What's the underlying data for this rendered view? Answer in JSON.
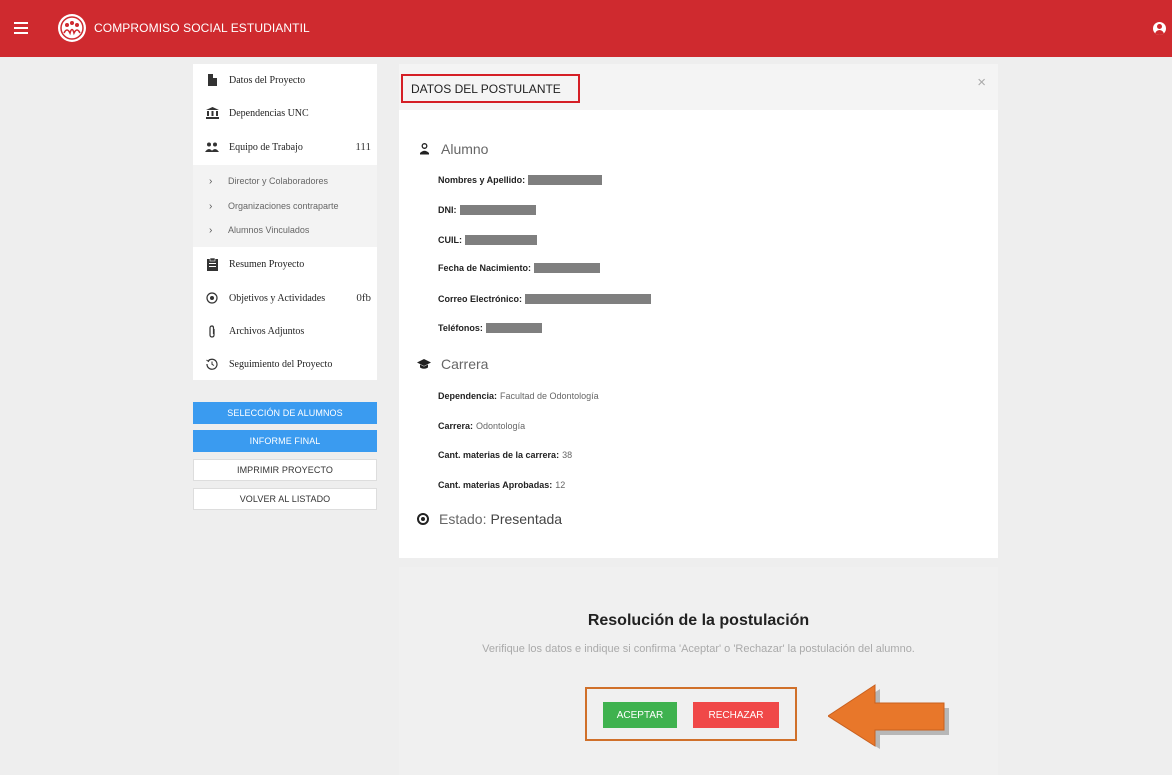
{
  "header": {
    "app_title": "COMPROMISO SOCIAL ESTUDIANTIL",
    "brand_color": "#cf2a2f"
  },
  "sidebar": {
    "items": [
      {
        "label": "Datos del Proyecto",
        "icon": "document-icon"
      },
      {
        "label": "Dependencias UNC",
        "icon": "institution-icon"
      },
      {
        "label": "Equipo de Trabajo",
        "icon": "people-icon",
        "badge": "111"
      },
      {
        "label": "Resumen Proyecto",
        "icon": "clipboard-icon"
      },
      {
        "label": "Objetivos y Actividades",
        "icon": "target-icon",
        "badge": "0fb"
      },
      {
        "label": "Archivos Adjuntos",
        "icon": "paperclip-icon"
      },
      {
        "label": "Seguimiento del Proyecto",
        "icon": "history-icon"
      }
    ],
    "subitems": [
      {
        "label": "Director y Colaboradores"
      },
      {
        "label": "Organizaciones contraparte"
      },
      {
        "label": "Alumnos Vinculados"
      }
    ]
  },
  "actions": {
    "seleccion": "SELECCIÓN DE ALUMNOS",
    "informe": "INFORME FINAL",
    "imprimir": "IMPRIMIR PROYECTO",
    "volver": "VOLVER AL LISTADO"
  },
  "card": {
    "title": "DATOS DEL POSTULANTE",
    "close": "×",
    "alumno_heading": "Alumno",
    "alumno_fields": [
      {
        "label": "Nombres y Apellido:"
      },
      {
        "label": "DNI:"
      },
      {
        "label": "CUIL:"
      },
      {
        "label": "Fecha de Nacimiento:"
      },
      {
        "label": "Correo Electrónico:"
      },
      {
        "label": "Teléfonos:"
      }
    ],
    "carrera_heading": "Carrera",
    "carrera_fields": [
      {
        "label": "Dependencia:",
        "value": "Facultad de Odontología"
      },
      {
        "label": "Carrera:",
        "value": "Odontología"
      },
      {
        "label": "Cant. materias de la carrera:",
        "value": "38"
      },
      {
        "label": "Cant. materias Aprobadas:",
        "value": "12"
      }
    ],
    "estado_label": "Estado:",
    "estado_value": "Presentada"
  },
  "resolucion": {
    "title": "Resolución de la postulación",
    "description": "Verifique los datos e indique si confirma 'Aceptar' o 'Rechazar' la postulación del alumno.",
    "accept": "ACEPTAR",
    "reject": "RECHAZAR"
  }
}
